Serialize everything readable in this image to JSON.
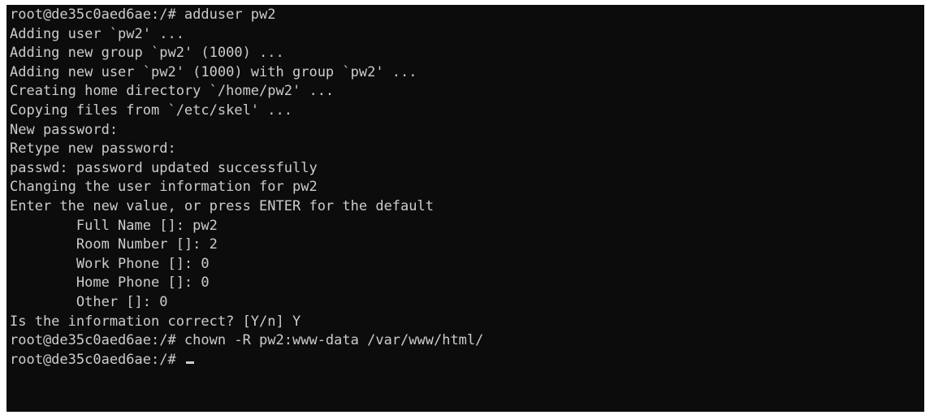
{
  "terminal": {
    "lines": [
      "root@de35c0aed6ae:/# adduser pw2",
      "Adding user `pw2' ...",
      "Adding new group `pw2' (1000) ...",
      "Adding new user `pw2' (1000) with group `pw2' ...",
      "Creating home directory `/home/pw2' ...",
      "Copying files from `/etc/skel' ...",
      "New password:",
      "Retype new password:",
      "passwd: password updated successfully",
      "Changing the user information for pw2",
      "Enter the new value, or press ENTER for the default",
      "        Full Name []: pw2",
      "        Room Number []: 2",
      "        Work Phone []: 0",
      "        Home Phone []: 0",
      "        Other []: 0",
      "Is the information correct? [Y/n] Y",
      "root@de35c0aed6ae:/# chown -R pw2:www-data /var/www/html/"
    ],
    "prompt": "root@de35c0aed6ae:/# "
  },
  "colors": {
    "background": "#0c0c0c",
    "foreground": "#cccccc"
  }
}
